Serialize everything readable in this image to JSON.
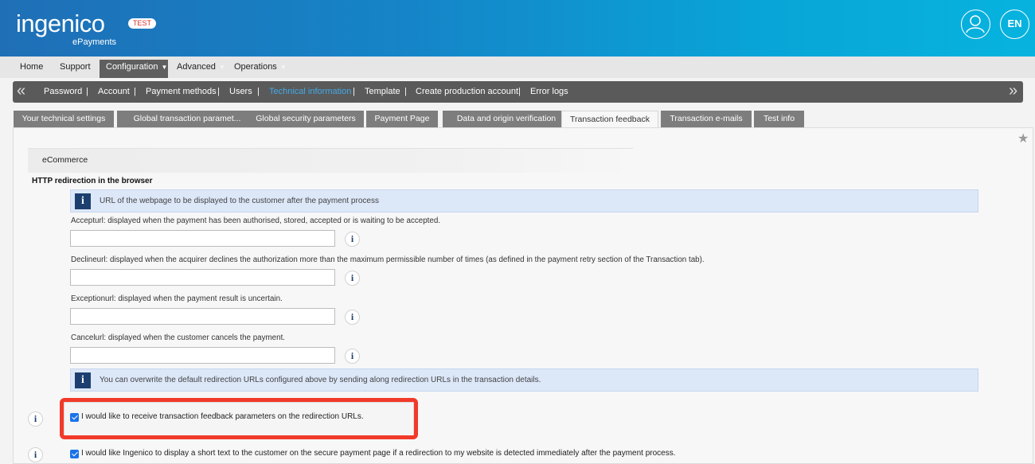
{
  "header": {
    "logo_main": "ingenico",
    "logo_sub": "ePayments",
    "env_badge": "TEST",
    "language": "EN"
  },
  "main_menu": [
    {
      "label": "Home"
    },
    {
      "label": "Support"
    },
    {
      "label": "Configuration",
      "active": true
    },
    {
      "label": "Advanced"
    },
    {
      "label": "Operations"
    }
  ],
  "sub_nav": [
    {
      "label": "Password"
    },
    {
      "label": "Account"
    },
    {
      "label": "Payment methods"
    },
    {
      "label": "Users"
    },
    {
      "label": "Technical information",
      "current": true
    },
    {
      "label": "Template"
    },
    {
      "label": "Create production account"
    },
    {
      "label": "Error logs"
    }
  ],
  "tabs": [
    {
      "label": "Your technical settings"
    },
    {
      "label": "Global transaction paramet..."
    },
    {
      "label": "Global security parameters"
    },
    {
      "label": "Payment Page"
    },
    {
      "label": "Data and origin verification"
    },
    {
      "label": "Transaction feedback",
      "active": true
    },
    {
      "label": "Transaction e-mails"
    },
    {
      "label": "Test info"
    }
  ],
  "content": {
    "section_title": "eCommerce",
    "block_title": "HTTP redirection in the browser",
    "info_top": "URL of the webpage to be displayed to the customer after the payment process",
    "fields": [
      {
        "label": "Accepturl: displayed when the payment has been authorised, stored, accepted or is waiting to be accepted.",
        "value": ""
      },
      {
        "label": "Declineurl: displayed when the acquirer declines the authorization more than the maximum permissible number of times (as defined in the payment retry section of the Transaction tab).",
        "value": ""
      },
      {
        "label": "Exceptionurl: displayed when the payment result is uncertain.",
        "value": ""
      },
      {
        "label": "Cancelurl: displayed when the customer cancels the payment.",
        "value": ""
      }
    ],
    "info_bottom": "You can overwrite the default redirection URLs configured above by sending along redirection URLs in the transaction details.",
    "checkbox_feedback": {
      "label": "I would like to receive transaction feedback parameters on the redirection URLs.",
      "checked": true
    },
    "checkbox_short_text": {
      "label": "I would like Ingenico to display a short text to the customer on the secure payment page if a redirection to my website is detected immediately after the payment process.",
      "checked": true
    }
  },
  "colors": {
    "header_start": "#1f6fb6",
    "header_end": "#07b3de",
    "highlight": "#f23a2a",
    "checkbox": "#1a73e8",
    "current_link": "#43a9e8"
  }
}
